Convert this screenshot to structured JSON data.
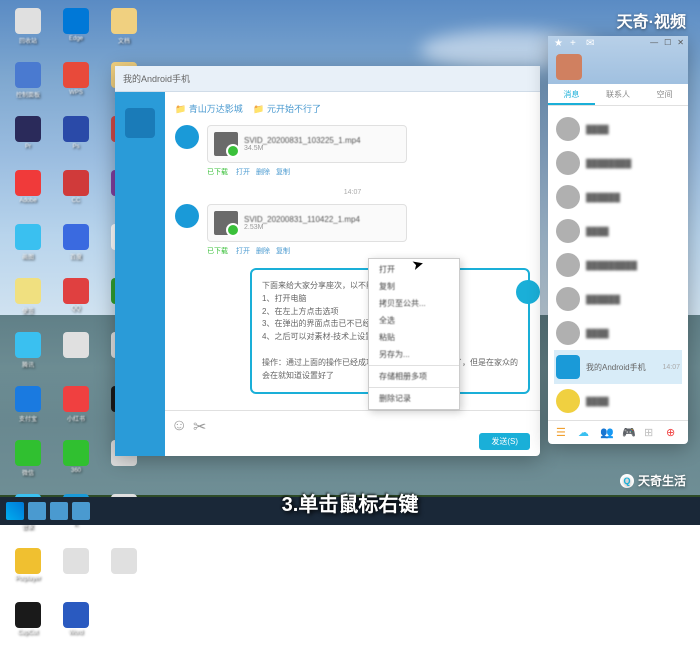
{
  "watermarks": {
    "top_right": "天奇·视频",
    "bottom_right": "天奇生活"
  },
  "caption": "3.单击鼠标右键",
  "desktop_icons": [
    {
      "label": "回收站",
      "color": "#e0e0e0"
    },
    {
      "label": "Edge",
      "color": "#0078d7"
    },
    {
      "label": "文档",
      "color": "#f0d080"
    },
    {
      "label": "控制面板",
      "color": "#4a7ad0"
    },
    {
      "label": "WPS",
      "color": "#e84a3a"
    },
    {
      "label": "文件夹",
      "color": "#f0d080"
    },
    {
      "label": "Pr",
      "color": "#2a2a5a"
    },
    {
      "label": "Ps",
      "color": "#2a4aa8"
    },
    {
      "label": "工具",
      "color": "#d04a4a"
    },
    {
      "label": "Adobe",
      "color": "#f03a3a"
    },
    {
      "label": "CC",
      "color": "#d03a3a"
    },
    {
      "label": "",
      "color": "#8040a0"
    },
    {
      "label": "画图",
      "color": "#3ac0f0"
    },
    {
      "label": "百度",
      "color": "#3a6ae0"
    },
    {
      "label": "",
      "color": "#ffffff"
    },
    {
      "label": "便签",
      "color": "#f0e080"
    },
    {
      "label": "QQ",
      "color": "#e04040"
    },
    {
      "label": "音乐",
      "color": "#30a030"
    },
    {
      "label": "腾讯",
      "color": "#3ac0f0"
    },
    {
      "label": "",
      "color": "#e0e0e0"
    },
    {
      "label": "",
      "color": "#e0e0e0"
    },
    {
      "label": "支付宝",
      "color": "#1a7ae0"
    },
    {
      "label": "小红书",
      "color": "#f04040"
    },
    {
      "label": "抖音",
      "color": "#1a1a1a"
    },
    {
      "label": "微信",
      "color": "#30c030"
    },
    {
      "label": "360",
      "color": "#30c030"
    },
    {
      "label": "",
      "color": "#e0e0e0"
    },
    {
      "label": "管家",
      "color": "#3ac0f0"
    },
    {
      "label": "K",
      "color": "#1a9ad8"
    },
    {
      "label": "",
      "color": "#e0e0e0"
    },
    {
      "label": "Potplayer",
      "color": "#f0c030"
    },
    {
      "label": "",
      "color": "#e0e0e0"
    },
    {
      "label": "",
      "color": "#e0e0e0"
    },
    {
      "label": "CapCut",
      "color": "#1a1a1a"
    },
    {
      "label": "Word",
      "color": "#2a5ac0"
    }
  ],
  "chat": {
    "title": "我的Android手机",
    "breadcrumb": [
      "青山万达影城",
      "元开始不行了"
    ],
    "messages": [
      {
        "type": "file",
        "filename": "SVID_20200831_103225_1.mp4",
        "size": "34.5M",
        "status": "已下载",
        "actions": [
          "打开",
          "删除",
          "复制"
        ]
      },
      {
        "type": "time",
        "text": "14:07"
      },
      {
        "type": "file",
        "filename": "SVID_20200831_110422_1.mp4",
        "size": "2.53M",
        "status": "已下载",
        "actions": [
          "打开",
          "删除",
          "复制"
        ]
      },
      {
        "type": "text",
        "lines": [
          "下面来给大家分享座次，以不能说是听听",
          "1、打开电脑",
          "2、在左上方点击选项",
          "3、在弹出的界面点击已不已经看到了",
          "4、之后可以对素材-技术上设置保存了",
          "",
          "操作：通过上面的操作已经成功被设置动力也已经进行了，但是在家众的会在就知道设置好了"
        ]
      }
    ],
    "send_button": "发送(S)"
  },
  "context_menu": {
    "items": [
      "打开",
      "复制",
      "拷贝至公共...",
      "全选",
      "粘贴",
      "另存为...",
      "",
      "存储相册多项",
      "",
      "删除记录"
    ]
  },
  "contacts": {
    "tabs": [
      "消息",
      "联系人",
      "空间"
    ],
    "active_tab": 0,
    "items": [
      {
        "name": "████",
        "time": ""
      },
      {
        "name": "████████",
        "time": ""
      },
      {
        "name": "██████",
        "time": ""
      },
      {
        "name": "████",
        "time": ""
      },
      {
        "name": "█████████",
        "time": ""
      },
      {
        "name": "██████",
        "time": ""
      },
      {
        "name": "████",
        "time": ""
      },
      {
        "name": "我的Android手机",
        "time": "14:07",
        "highlight": true
      },
      {
        "name": "████",
        "time": "",
        "yellow": true
      }
    ],
    "footer_colors": [
      "#f0a030",
      "#3ac0f0",
      "#8040c0",
      "#30c060",
      "#c0c0c0",
      "#f04040"
    ]
  }
}
